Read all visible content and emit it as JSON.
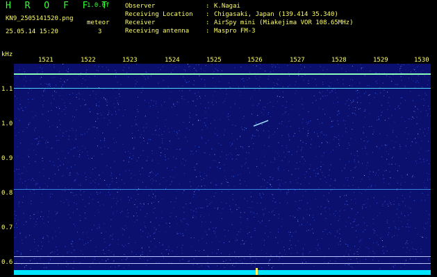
{
  "header": {
    "brand": "H R O F F T",
    "version": "1.0.0f",
    "filename": "KN9_2505141520.png",
    "timestamp": "25.05.14 15:20",
    "meteor_label": "meteor",
    "meteor_count": "3"
  },
  "info": [
    {
      "key": "Observer",
      "value": "K.Nagai"
    },
    {
      "key": "Receiving Location",
      "value": "Chigasaki, Japan (139.414 35.340)"
    },
    {
      "key": "Receiver",
      "value": "AirSpy mini (Miakejima VOR 108.65MHz)"
    },
    {
      "key": "Receiving antenna",
      "value": "Maspro FM-3"
    }
  ],
  "axes": {
    "y_unit": "kHz",
    "y_ticks": [
      "1.1",
      "1.0",
      "0.9",
      "0.8",
      "0.7",
      "0.6"
    ],
    "x_ticks": [
      "1521",
      "1522",
      "1523",
      "1524",
      "1525",
      "1526",
      "1527",
      "1528",
      "1529",
      "1530"
    ]
  },
  "colors": {
    "background": "#0b0f6e",
    "noise": "#3a6cff",
    "carrier": "#88ffbb",
    "line": "#4fd6ff",
    "baseline": "#00e5ff",
    "text": "#ffff66",
    "brand": "#33ff33"
  }
}
